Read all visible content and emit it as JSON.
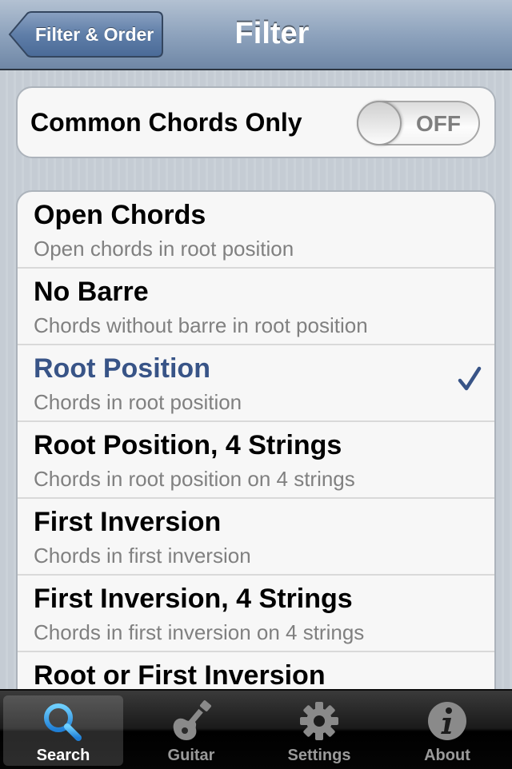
{
  "nav": {
    "back_label": "Filter & Order",
    "title": "Filter"
  },
  "toggle": {
    "label": "Common Chords Only",
    "state_label": "OFF"
  },
  "filters": [
    {
      "title": "Open Chords",
      "subtitle": "Open chords in root position",
      "selected": false
    },
    {
      "title": "No Barre",
      "subtitle": "Chords without barre in root position",
      "selected": false
    },
    {
      "title": "Root Position",
      "subtitle": "Chords in root position",
      "selected": true
    },
    {
      "title": "Root Position, 4 Strings",
      "subtitle": "Chords in root position on 4 strings",
      "selected": false
    },
    {
      "title": "First Inversion",
      "subtitle": "Chords in first inversion",
      "selected": false
    },
    {
      "title": "First Inversion, 4 Strings",
      "subtitle": "Chords in first inversion on 4 strings",
      "selected": false
    },
    {
      "title": "Root or First Inversion",
      "subtitle": "",
      "selected": false
    }
  ],
  "tabs": [
    {
      "label": "Search",
      "icon": "search-icon",
      "active": true
    },
    {
      "label": "Guitar",
      "icon": "guitar-icon",
      "active": false
    },
    {
      "label": "Settings",
      "icon": "gear-icon",
      "active": false
    },
    {
      "label": "About",
      "icon": "info-icon",
      "active": false
    }
  ],
  "colors": {
    "selected_text": "#385487",
    "active_tab_icon": "#2e9ee8"
  }
}
